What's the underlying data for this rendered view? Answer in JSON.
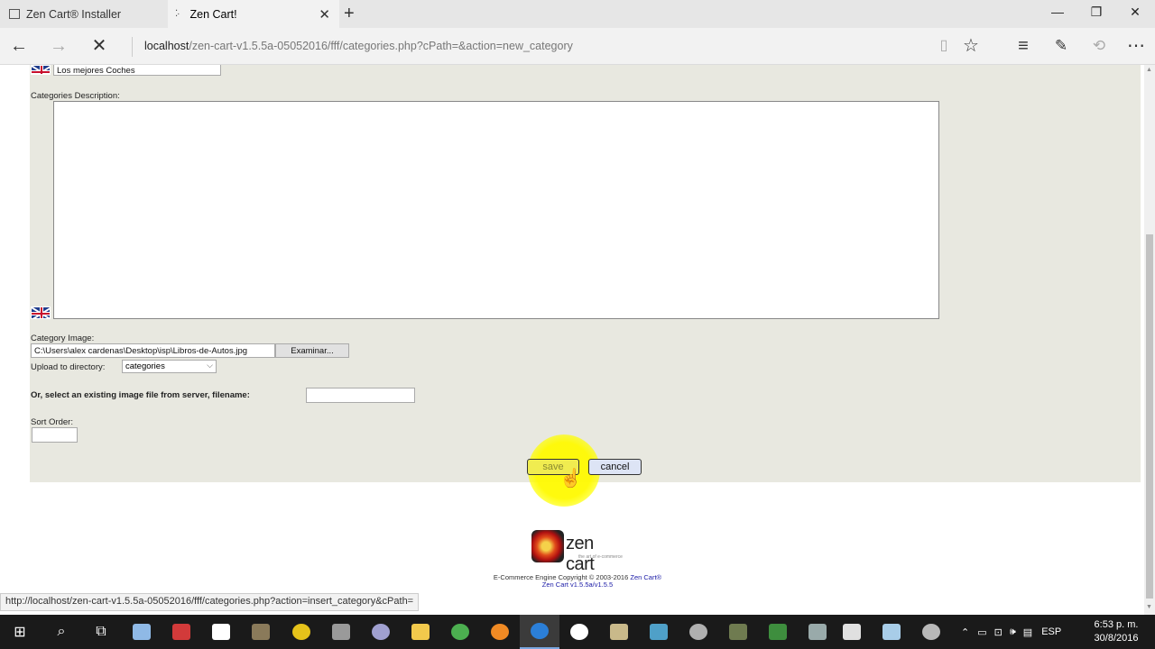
{
  "browser": {
    "tabs": [
      {
        "title": "Zen Cart® Installer"
      },
      {
        "title": "Zen Cart!",
        "loading": true
      }
    ],
    "address": {
      "host": "localhost",
      "path": "/zen-cart-v1.5.5a-05052016/fff/categories.php?cPath=&action=new_category"
    },
    "status_url": "http://localhost/zen-cart-v1.5.5a-05052016/fff/categories.php?action=insert_category&cPath="
  },
  "form": {
    "category_name_value": "Los mejores Coches",
    "description_label": "Categories Description:",
    "image_label": "Category Image:",
    "image_path_value": "C:\\Users\\alex cardenas\\Desktop\\isp\\Libros-de-Autos.jpg",
    "browse_label": "Examinar...",
    "upload_dir_label": "Upload to directory:",
    "upload_dir_value": "categories",
    "existing_image_label": "Or, select an existing image file from server, filename:",
    "existing_image_value": "",
    "sort_order_label": "Sort Order:",
    "sort_order_value": "",
    "save_label": "save",
    "cancel_label": "cancel"
  },
  "footer": {
    "logo_text": "zen cart",
    "logo_tagline": "the art of e-commerce",
    "copyright_prefix": "E-Commerce Engine Copyright © 2003-2016",
    "copyright_link": "Zen Cart®",
    "version": "Zen Cart v1.5.5a/v1.5.5"
  },
  "taskbar": {
    "language": "ESP",
    "time": "6:53 p. m.",
    "date": "30/8/2016"
  },
  "colors": {
    "panel_bg": "#e8e8e0",
    "save_button": "#f0ec50",
    "cancel_button": "#dde4f5",
    "cursor_highlight": "#fff500",
    "taskbar_bg": "#1a1a1a"
  }
}
